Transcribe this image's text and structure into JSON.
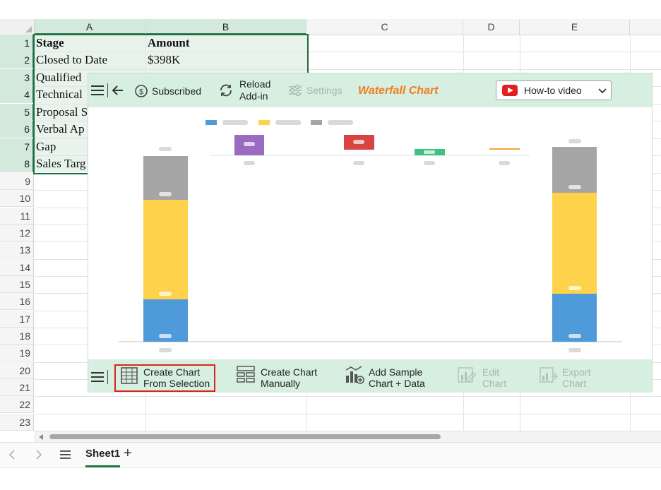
{
  "spreadsheet": {
    "columns": [
      "A",
      "B",
      "C",
      "D",
      "E"
    ],
    "rows": [
      "1",
      "2",
      "3",
      "4",
      "5",
      "6",
      "7",
      "8",
      "9",
      "10",
      "11",
      "12",
      "13",
      "14",
      "15",
      "16",
      "17",
      "18",
      "19",
      "20",
      "21",
      "22",
      "23"
    ],
    "cells": {
      "a1": "Stage",
      "b1": "Amount",
      "a2": "Closed to Date",
      "b2": "$398K",
      "a3": "Qualified",
      "a4": "Technical",
      "a5": "Proposal S",
      "a6": "Verbal Ap",
      "a7": "Gap",
      "a8": "Sales Targ"
    }
  },
  "addin": {
    "top": {
      "subscribed": "Subscribed",
      "reload_line1": "Reload",
      "reload_line2": "Add-in",
      "settings": "Settings",
      "brand": "Waterfall Chart",
      "howto": "How-to video"
    },
    "bottom": {
      "create_sel_1": "Create Chart",
      "create_sel_2": "From Selection",
      "create_man_1": "Create Chart",
      "create_man_2": "Manually",
      "add_sample_1": "Add Sample",
      "add_sample_2": "Chart + Data",
      "edit_1": "Edit",
      "edit_2": "Chart",
      "export_1": "Export",
      "export_2": "Chart"
    },
    "colors": {
      "blue": "#4f9ad8",
      "yellow": "#fed24a",
      "gray": "#a5a5a5",
      "purple": "#9b6ac2",
      "red": "#d94443",
      "green": "#3fc27f",
      "orange": "#f4a23c",
      "brand": "#f07c1f"
    }
  },
  "status": {
    "sheet_tab": "Sheet1",
    "add_sheet": "+"
  }
}
